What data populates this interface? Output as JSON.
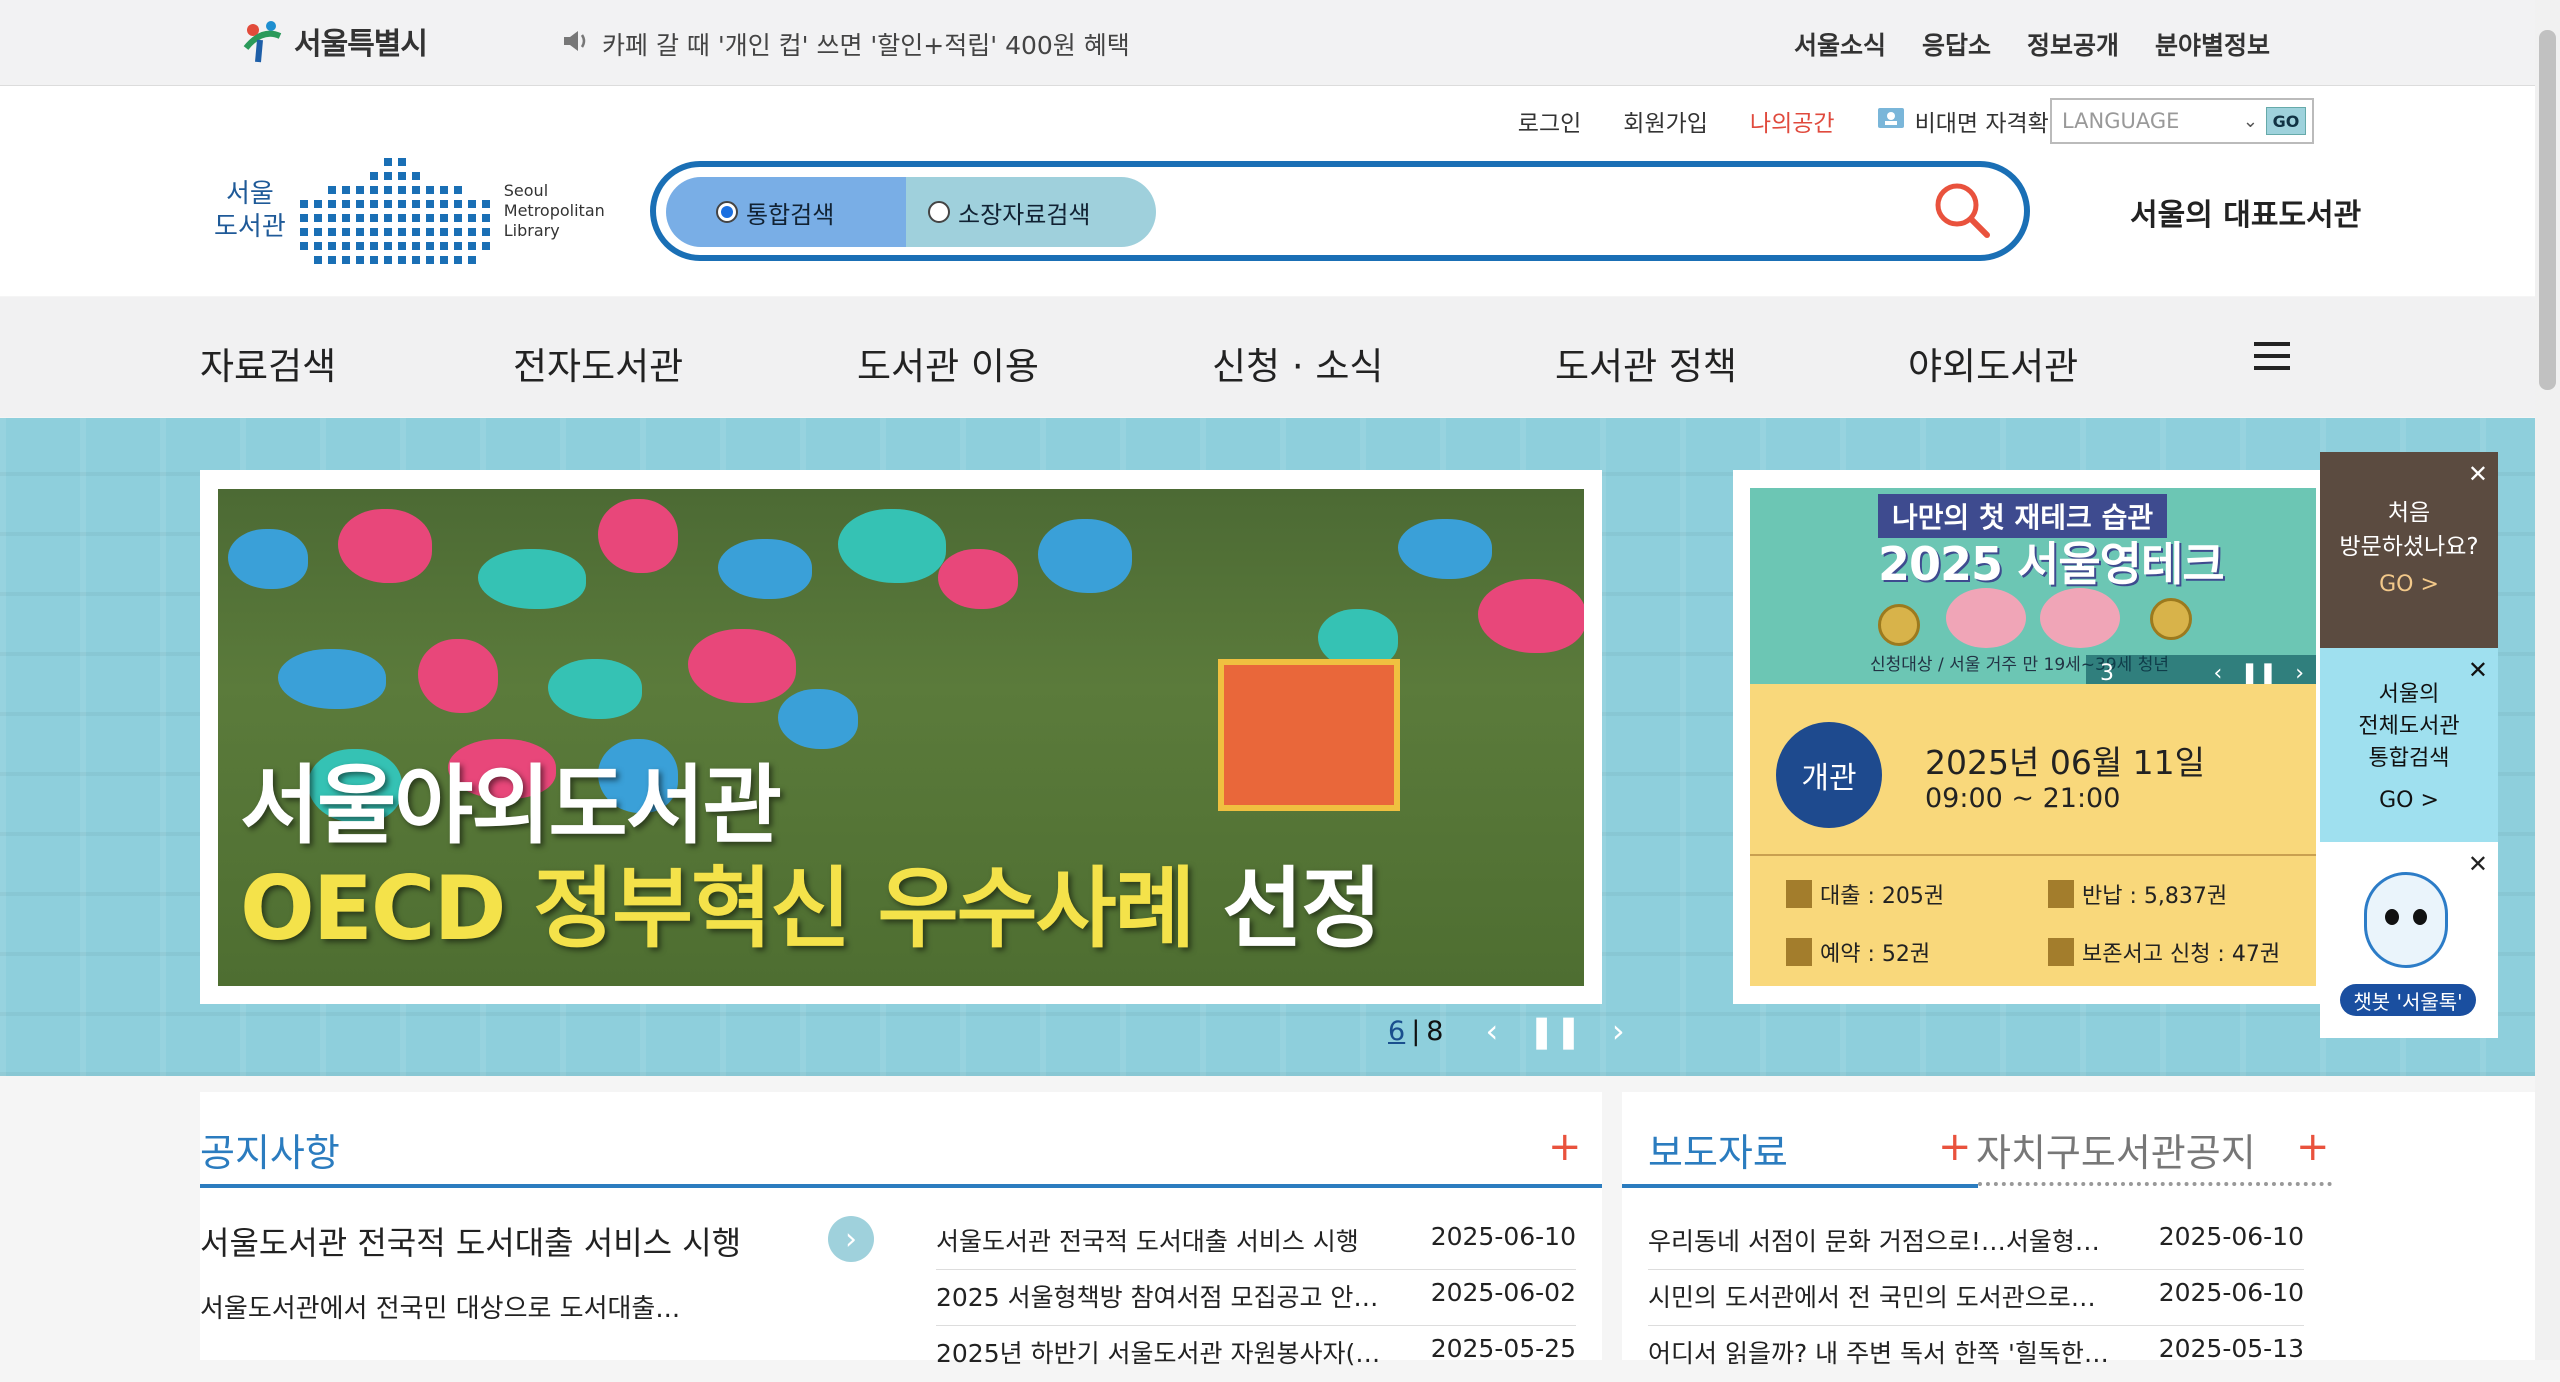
{
  "topbar": {
    "logo_text": "서울특별시",
    "notice": "카페 갈 때 '개인 컵' 쓰면 '할인+적립' 400원 혜택",
    "links": [
      "서울소식",
      "응답소",
      "정보공개",
      "분야별정보"
    ]
  },
  "header": {
    "util": {
      "login": "로그인",
      "join": "회원가입",
      "mine": "나의공간",
      "verify": "비대면 자격확인"
    },
    "language": {
      "label": "LANGUAGE",
      "go": "GO"
    },
    "logo": {
      "ko_line1": "서울",
      "ko_line2": "도서관",
      "en_line1": "Seoul",
      "en_line2": "Metropolitan",
      "en_line3": "Library"
    },
    "search": {
      "opt1": "통합검색",
      "opt2": "소장자료검색",
      "placeholder": ""
    },
    "brand_right": "서울의 대표도서관"
  },
  "nav": [
    "자료검색",
    "전자도서관",
    "도서관 이용",
    "신청 · 소식",
    "도서관 정책",
    "야외도서관"
  ],
  "hero": {
    "title_line1": "서울야외도서관",
    "title_line2_yellow": "OECD 정부혁신 우수사례",
    "title_line2_white": " 선정",
    "page_current": "6",
    "page_sep": "|",
    "page_total": "8"
  },
  "info": {
    "banner": {
      "tag": "나만의 첫 재테크 습관",
      "title": "2025 서울영테크",
      "sub": "신청대상 / 서울 거주 만 19세~39세 청년",
      "page": "3"
    },
    "open_badge": "개관",
    "date": "2025년 06월 11일",
    "time": "09:00 ~ 21:00",
    "stats": {
      "loan": "대출 : 205권",
      "return": "반납 : 5,837권",
      "reserve": "예약 : 52권",
      "storage": "보존서고 신청 : 47권"
    }
  },
  "quick": {
    "first_visit": {
      "line1": "처음",
      "line2": "방문하셨나요?",
      "go": "GO  >"
    },
    "integrated": {
      "line1": "서울의",
      "line2": "전체도서관",
      "line3": "통합검색",
      "go": "GO  >"
    },
    "chatbot": {
      "tag": "챗봇 '서울톡'"
    }
  },
  "notices": {
    "title": "공지사항",
    "feature_title": "서울도서관 전국적 도서대출 서비스 시행",
    "feature_sub": "서울도서관에서 전국민 대상으로 도서대출...",
    "items": [
      {
        "title": "서울도서관 전국적 도서대출 서비스 시행",
        "date": "2025-06-10"
      },
      {
        "title": "2025 서울형책방 참여서점 모집공고 안…",
        "date": "2025-06-02"
      },
      {
        "title": "2025년 하반기 서울도서관 자원봉사자(…",
        "date": "2025-05-25"
      }
    ]
  },
  "press": {
    "title": "보도자료",
    "tab2": "자치구도서관공지",
    "items": [
      {
        "title": "우리동네 서점이 문화 거점으로!…서울형…",
        "date": "2025-06-10"
      },
      {
        "title": "시민의 도서관에서 전 국민의 도서관으로…",
        "date": "2025-06-10"
      },
      {
        "title": "어디서 읽을까? 내 주변 독서 한쪽 '힐독한…",
        "date": "2025-05-13"
      }
    ]
  },
  "colors": {
    "primary": "#1a6fb5",
    "hero_bg": "#8ecfdc",
    "accent": "#e9523d",
    "info_yellow": "#f9d87b"
  }
}
